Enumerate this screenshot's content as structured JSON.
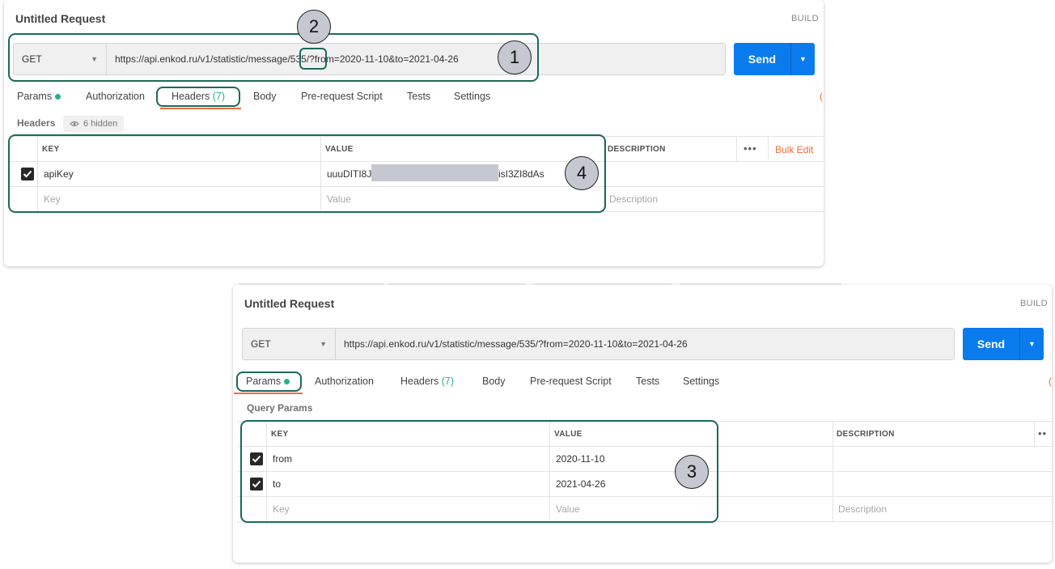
{
  "top": {
    "title": "Untitled Request",
    "build": "BUILD",
    "method": "GET",
    "url_part1": "https://api.enkod.ru/v1/statistic/message/",
    "url_part2": "535",
    "url_part3": "/?from=2020-11-10&to=2021-04-26",
    "send": "Send",
    "tabs": {
      "params": "Params",
      "authorization": "Authorization",
      "headers": "Headers",
      "headers_count": "(7)",
      "body": "Body",
      "prerequest": "Pre-request Script",
      "tests": "Tests",
      "settings": "Settings"
    },
    "section": "Headers",
    "hidden": "6 hidden",
    "table": {
      "key_header": "KEY",
      "value_header": "VALUE",
      "description_header": "DESCRIPTION",
      "bulk_edit": "Bulk Edit",
      "row_key": "apiKey",
      "row_value_start": "uuuDITI8J",
      "row_value_end": "isI3ZI8dAs",
      "key_placeholder": "Key",
      "value_placeholder": "Value",
      "description_placeholder": "Description"
    }
  },
  "bottom": {
    "title": "Untitled Request",
    "build": "BUILD",
    "method": "GET",
    "url": "https://api.enkod.ru/v1/statistic/message/535/?from=2020-11-10&to=2021-04-26",
    "send": "Send",
    "tabs": {
      "params": "Params",
      "authorization": "Authorization",
      "headers": "Headers",
      "headers_count": "(7)",
      "body": "Body",
      "prerequest": "Pre-request Script",
      "tests": "Tests",
      "settings": "Settings"
    },
    "section": "Query Params",
    "table": {
      "key_header": "KEY",
      "value_header": "VALUE",
      "description_header": "DESCRIPTION",
      "rows": [
        {
          "key": "from",
          "value": "2020-11-10"
        },
        {
          "key": "to",
          "value": "2021-04-26"
        }
      ],
      "key_placeholder": "Key",
      "value_placeholder": "Value",
      "description_placeholder": "Description"
    }
  },
  "badges": [
    "1",
    "2",
    "3",
    "4"
  ],
  "colors": {
    "highlight": "#1a6b58",
    "accent": "#f26b3a",
    "send": "#097bed",
    "status_dot": "#26b47f",
    "badge_fill": "#c5c7d1"
  },
  "icons": [
    "caret-down-icon",
    "eye-icon",
    "checkmark-icon",
    "more-dots-icon"
  ]
}
